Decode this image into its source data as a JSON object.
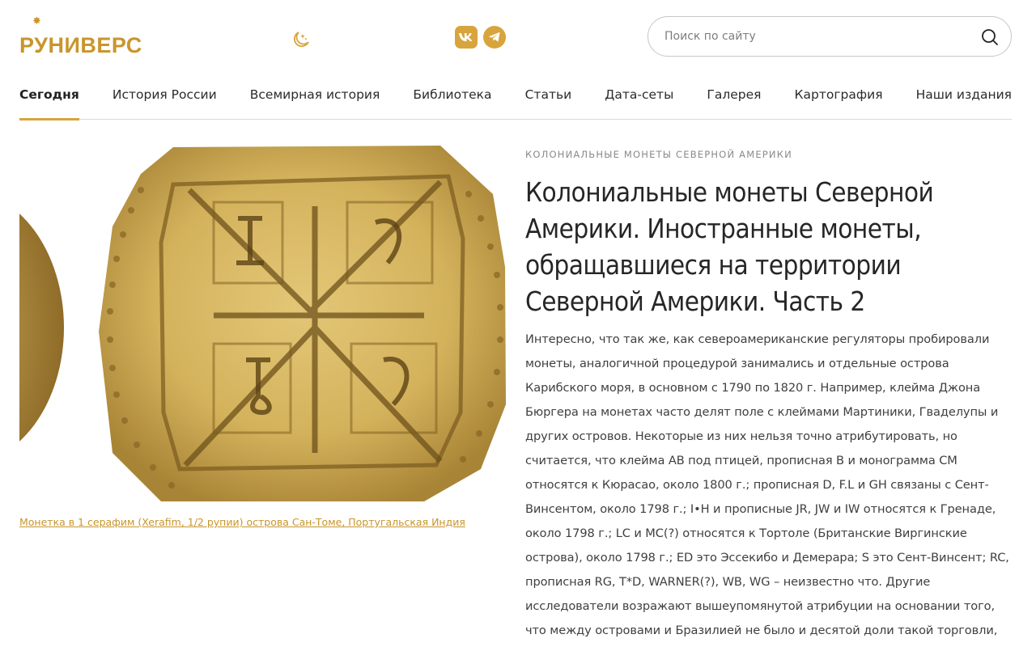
{
  "header": {
    "logo_text": "РУНИВЕРС",
    "logo_star": "✸",
    "search_placeholder": "Поиск по сайту",
    "accent_color": "#d8a43c",
    "icons": {
      "theme": "moon-stars-icon",
      "vk": "vk-icon",
      "telegram": "telegram-icon",
      "search": "search-icon"
    }
  },
  "nav": {
    "items": [
      {
        "label": "Сегодня",
        "active": true
      },
      {
        "label": "История России"
      },
      {
        "label": "Всемирная история"
      },
      {
        "label": "Библиотека"
      },
      {
        "label": "Статьи"
      },
      {
        "label": "Дата-сеты"
      },
      {
        "label": "Галерея"
      },
      {
        "label": "Картография"
      },
      {
        "label": "Наши издания"
      }
    ]
  },
  "figure": {
    "caption": "Монетка в 1 серафим (Xerafim, 1/2 рупии) острова Сан-Томе, Португальская Индия"
  },
  "article": {
    "kicker": "КОЛОНИАЛЬНЫЕ МОНЕТЫ СЕВЕРНОЙ АМЕРИКИ",
    "title": "Колониальные монеты Северной Америки. Иностранные монеты, обращавшиеся на территории Северной Америки. Часть 2",
    "body": "Интересно, что так же, как североамериканские регуляторы пробировали монеты, аналогичной процедурой занимались и отдельные острова Карибского моря, в основном с 1790 по 1820 г. Например, клейма Джона Бюргера на монетах часто делят поле с клеймами Мартиники, Гваделупы и других островов. Некоторые из них нельзя точно атрибутировать, но считается, что клейма AB под птицей, прописная B и монограмма CM относятся к Кюрасао, около 1800 г.; прописная D, F.L и GH связаны с Сент-Винсентом, около 1798 г.; I•H и прописные JR, JW и IW относятся к Гренаде, около 1798 г.; LC и MC(?) относятся к Тортоле (Британские Виргинские острова), около 1798 г.; ED это Эссекибо и Демерара; S это Сент-Винсент; RC, прописная RG, T*D, WARNER(?), WB, WG – неизвестно что. Другие исследователи возражают вышеупомянутой атрибуции на основании того, что между островами и Бразилией не было и десятой доли такой торговли,"
  }
}
